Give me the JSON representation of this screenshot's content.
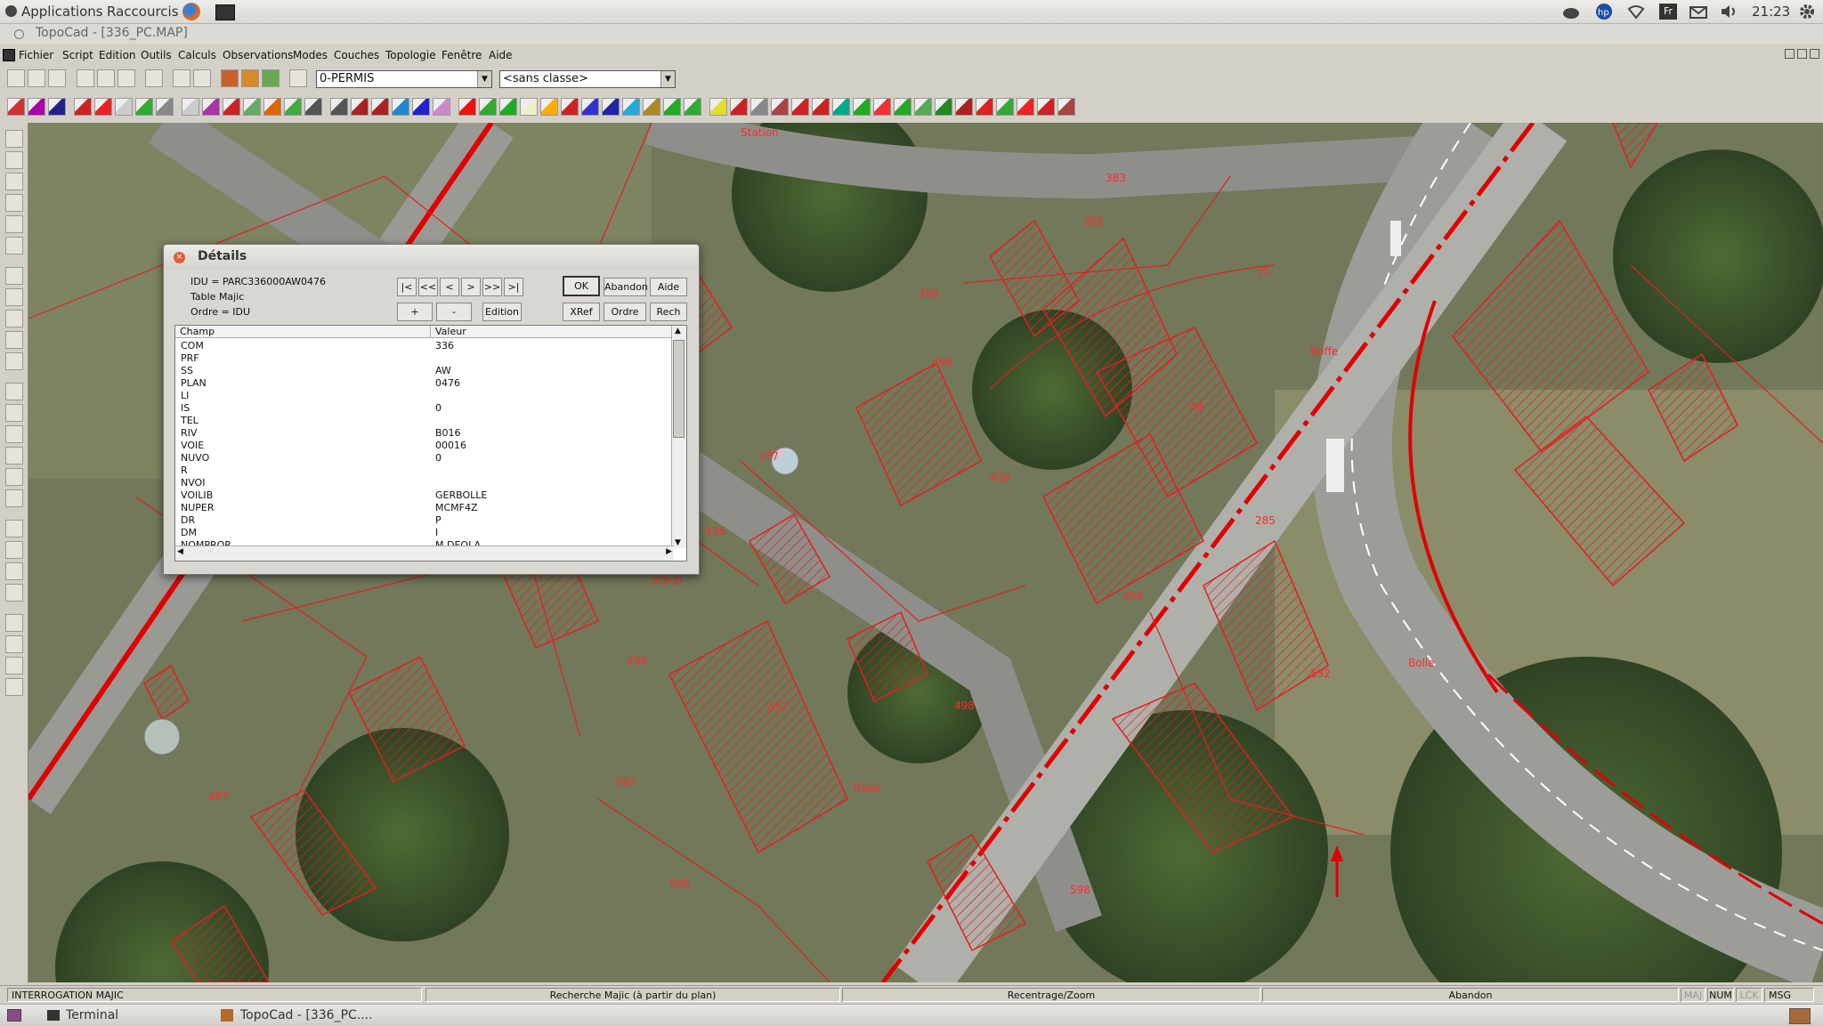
{
  "panel": {
    "applications": "Applications",
    "shortcuts": "Raccourcis",
    "keyboard": "Fr",
    "clock": "21:23"
  },
  "window": {
    "title": "TopoCad - [336_PC.MAP]"
  },
  "menu": [
    "Fichier",
    "Script",
    "Edition",
    "Outils",
    "Calculs",
    "Observations",
    "Modes",
    "Couches",
    "Topologie",
    "Fenêtre",
    "Aide"
  ],
  "toolbar": {
    "layer_value": "0-PERMIS",
    "class_value": "<sans classe>"
  },
  "map": {
    "parcel_labels": [
      "Station",
      "383",
      "382",
      "75",
      "399",
      "498",
      "38",
      "377",
      "430",
      "436",
      "285",
      "Boffe",
      "VOI D",
      "430",
      "456",
      "507",
      "498",
      "437",
      "Tralle",
      "596",
      "467",
      "598",
      "532",
      "Bolle"
    ]
  },
  "dialog": {
    "title": "Détails",
    "info": [
      "IDU = PARC336000AW0476",
      "Table Majic",
      "Ordre = IDU"
    ],
    "nav": [
      "|<",
      "<<",
      "<",
      ">",
      ">>",
      ">|"
    ],
    "buttons": {
      "ok": "OK",
      "abandon": "Abandon",
      "aide": "Aide",
      "plus": "+",
      "minus": "-",
      "edition": "Edition",
      "xref": "XRef",
      "ordre": "Ordre",
      "rech": "Rech"
    },
    "columns": [
      "Champ",
      "Valeur"
    ],
    "rows": [
      [
        "COM",
        "336"
      ],
      [
        "PRF",
        ""
      ],
      [
        "SS",
        "AW"
      ],
      [
        "PLAN",
        "0476"
      ],
      [
        "LI",
        ""
      ],
      [
        "IS",
        "0"
      ],
      [
        "TEL",
        ""
      ],
      [
        "RIV",
        "B016"
      ],
      [
        "VOIE",
        "00016"
      ],
      [
        "NUVO",
        "0"
      ],
      [
        "R",
        ""
      ],
      [
        "NVOI",
        ""
      ],
      [
        "VOILIB",
        "GERBOLLE"
      ],
      [
        "NUPER",
        "MCMF4Z"
      ],
      [
        "DR",
        "P"
      ],
      [
        "DM",
        "I"
      ],
      [
        "NOMPROP",
        "M   DEOLA"
      ]
    ]
  },
  "status": {
    "mode": "INTERROGATION MAJIC",
    "action": "Recherche Majic (à partir du plan)",
    "zoom": "Recentrage/Zoom",
    "cancel": "Abandon",
    "maj": "MAJ",
    "num": "NUM",
    "lck": "LCK",
    "msg": "MSG"
  },
  "taskbar": {
    "terminal": "Terminal",
    "topocad": "TopoCad - [336_PC...."
  }
}
